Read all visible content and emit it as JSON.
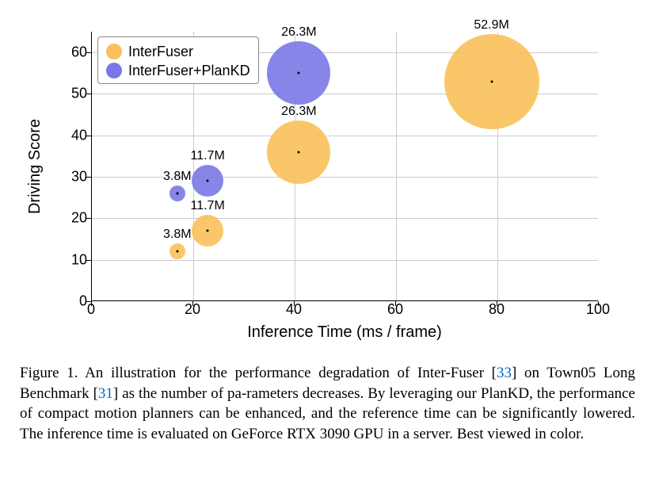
{
  "chart_data": {
    "type": "scatter",
    "title": "",
    "xlabel": "Inference Time (ms / frame)",
    "ylabel": "Driving Score",
    "xlim": [
      0,
      100
    ],
    "ylim": [
      0,
      65
    ],
    "x_ticks": [
      0,
      20,
      40,
      60,
      80,
      100
    ],
    "y_ticks": [
      0,
      10,
      20,
      30,
      40,
      50,
      60
    ],
    "series": [
      {
        "name": "InterFuser",
        "color": "#f8c15a",
        "points": [
          {
            "x": 17,
            "y": 12,
            "size_m": 3.8,
            "label": "3.8M",
            "radius_px": 10
          },
          {
            "x": 23,
            "y": 17,
            "size_m": 11.7,
            "label": "11.7M",
            "radius_px": 20
          },
          {
            "x": 41,
            "y": 36,
            "size_m": 26.3,
            "label": "26.3M",
            "radius_px": 40
          },
          {
            "x": 79,
            "y": 53,
            "size_m": 52.9,
            "label": "52.9M",
            "radius_px": 60
          }
        ]
      },
      {
        "name": "InterFuser+PlanKD",
        "color": "#7a78e6",
        "points": [
          {
            "x": 17,
            "y": 26,
            "size_m": 3.8,
            "label": "3.8M",
            "radius_px": 10
          },
          {
            "x": 23,
            "y": 29,
            "size_m": 11.7,
            "label": "11.7M",
            "radius_px": 20
          },
          {
            "x": 41,
            "y": 55,
            "size_m": 26.3,
            "label": "26.3M",
            "radius_px": 40
          }
        ]
      }
    ],
    "legend_position": "upper-left"
  },
  "legend": {
    "items": [
      "InterFuser",
      "InterFuser+PlanKD"
    ]
  },
  "caption": {
    "prefix": "Figure 1.",
    "text_parts": [
      "An illustration for the performance degradation of Inter-Fuser [",
      "] on Town05 Long Benchmark [",
      "] as the number of pa-rameters decreases. By leveraging our PlanKD, the performance of compact motion planners can be enhanced, and the reference time can be significantly lowered. The inference time is evaluated on GeForce RTX 3090 GPU in a server. Best viewed in color."
    ],
    "cite1": "33",
    "cite2": "31"
  }
}
